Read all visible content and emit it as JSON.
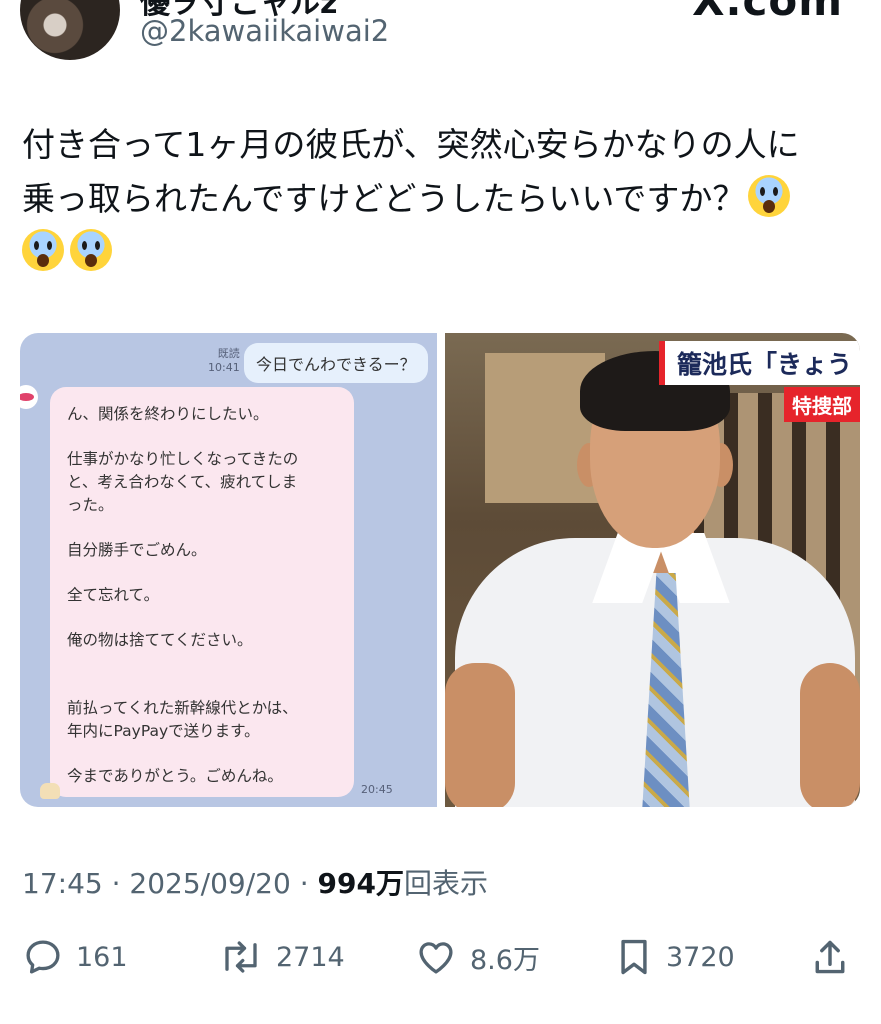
{
  "header": {
    "display_name": "優ヲ寸こャルz",
    "handle": "@2kawaiikaiwai2",
    "brand": "X.com"
  },
  "tweet": {
    "line1": "付き合って1ヶ月の彼氏が、突然心安らかなりの人に",
    "line2": "乗っ取られたんですけどどうしたらいいですか？",
    "emoji_icon": "face-screaming-in-fear-icon"
  },
  "chat": {
    "read_label": "既読",
    "read_time": "10:41",
    "outgoing": "今日でんわできるー？",
    "incoming": [
      "ん、関係を終わりにしたい。",
      "仕事がかなり忙しくなってきたの\nと、考え合わなくて、疲れてしま\nった。",
      "自分勝手でごめん。",
      "全て忘れて。",
      "俺の物は捨ててください。",
      "前払ってくれた新幹線代とかは、\n年内にPayPayで送ります。",
      "今までありがとう。ごめんね。"
    ],
    "incoming_time": "20:45"
  },
  "photo": {
    "banner": "籠池氏「きょう",
    "sub": "特捜部"
  },
  "meta": {
    "time": "17:45",
    "date": "2025/09/20",
    "views": "994万",
    "views_label": "回表示"
  },
  "actions": {
    "replies": "161",
    "reposts": "2714",
    "likes": "8.6万",
    "bookmarks": "3720"
  },
  "colors": {
    "text": "#0f1419",
    "secondary": "#536471",
    "chat_bg": "#b8c6e3",
    "bubble_in": "#fbe7ef",
    "bubble_out": "#e6f0fc",
    "news_red": "#e6242b"
  }
}
